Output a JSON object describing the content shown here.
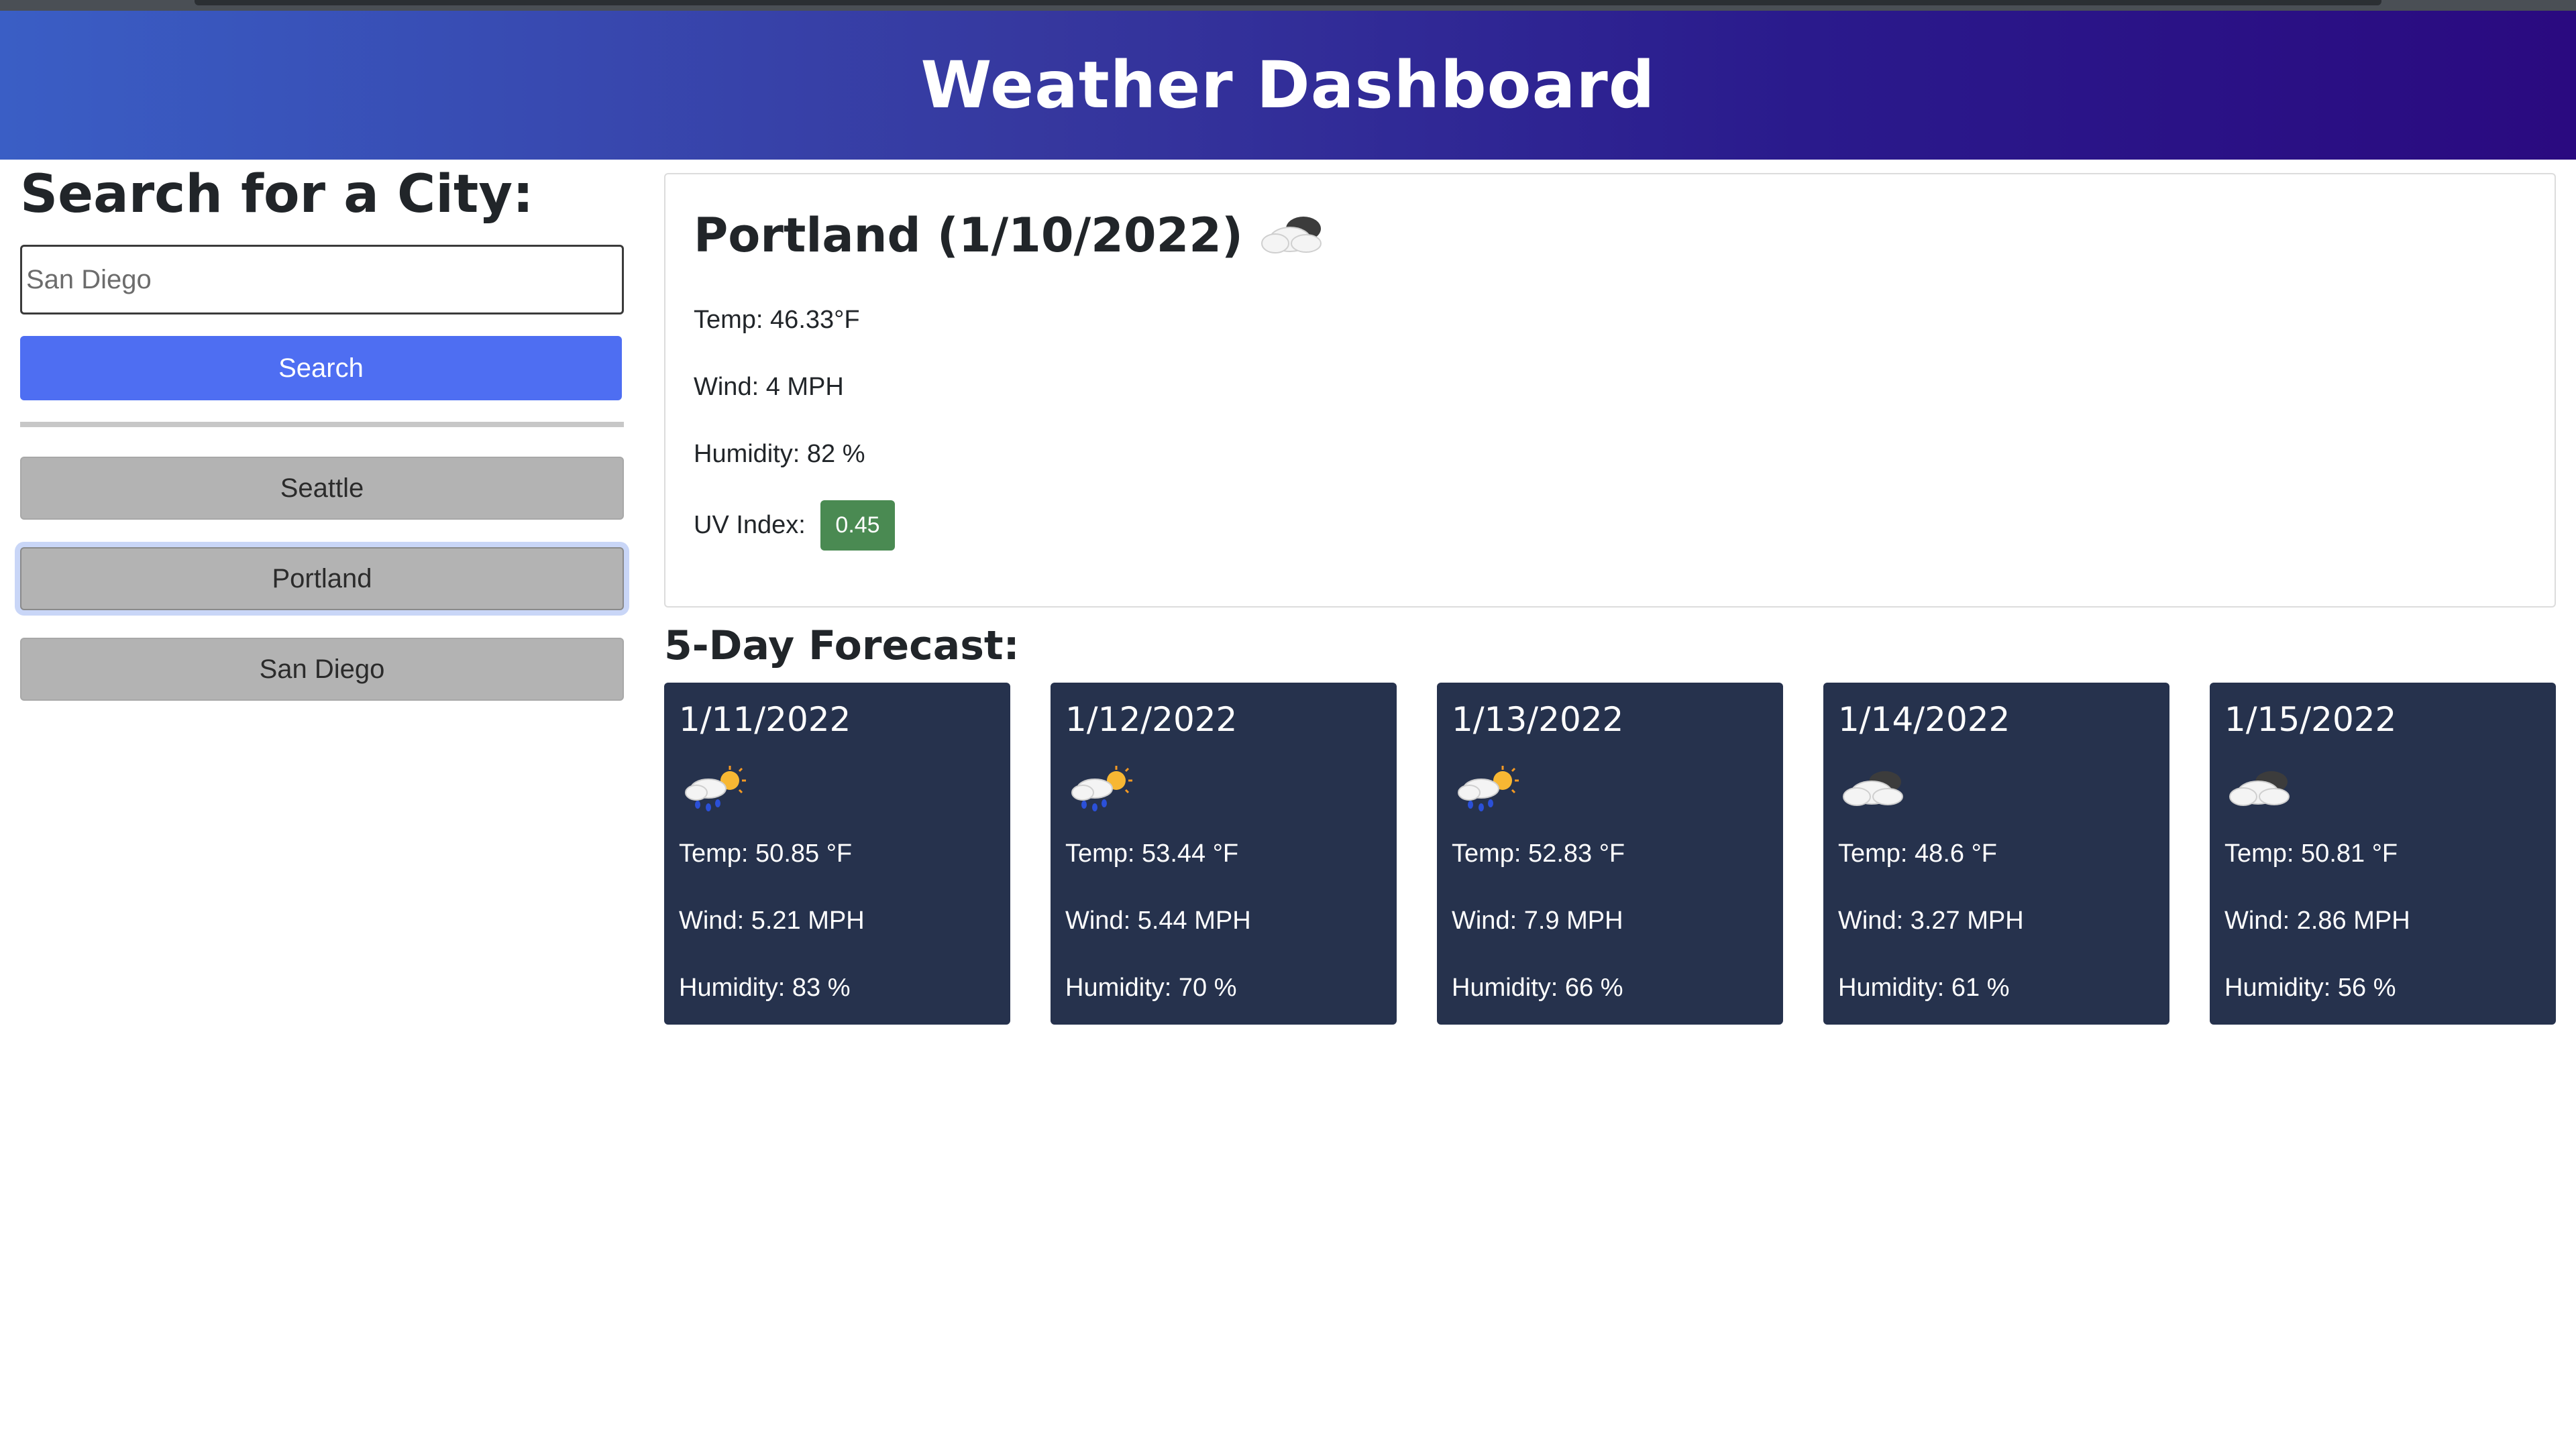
{
  "app": {
    "title": "Weather Dashboard"
  },
  "sidebar": {
    "heading": "Search for a City:",
    "search_placeholder": "San Diego",
    "search_button": "Search",
    "history": [
      "Seattle",
      "Portland",
      "San Diego"
    ],
    "active_history": "Portland"
  },
  "current": {
    "title": "Portland (1/10/2022)",
    "icon": "cloud-icon",
    "temp_label": "Temp: ",
    "temp_value": "46.33°F",
    "wind_label": "Wind: ",
    "wind_value": "4 MPH",
    "humidity_label": "Humidity: ",
    "humidity_value": "82 %",
    "uv_label": "UV Index: ",
    "uv_value": "0.45",
    "uv_color": "#4a8a52"
  },
  "forecast": {
    "heading": "5-Day Forecast:",
    "temp_label": "Temp: ",
    "wind_label": "Wind: ",
    "humidity_label": "Humidity: ",
    "days": [
      {
        "date": "1/11/2022",
        "icon": "rain-sun-icon",
        "temp": "50.85 °F",
        "wind": "5.21 MPH",
        "humidity": "83 %"
      },
      {
        "date": "1/12/2022",
        "icon": "rain-sun-icon",
        "temp": "53.44 °F",
        "wind": "5.44 MPH",
        "humidity": "70 %"
      },
      {
        "date": "1/13/2022",
        "icon": "rain-sun-icon",
        "temp": "52.83 °F",
        "wind": "7.9 MPH",
        "humidity": "66 %"
      },
      {
        "date": "1/14/2022",
        "icon": "cloud-icon",
        "temp": "48.6 °F",
        "wind": "3.27 MPH",
        "humidity": "61 %"
      },
      {
        "date": "1/15/2022",
        "icon": "cloud-icon",
        "temp": "50.81 °F",
        "wind": "2.86 MPH",
        "humidity": "56 %"
      }
    ]
  },
  "colors": {
    "header_gradient_start": "#3a5ec5",
    "header_gradient_end": "#2a0a80",
    "search_button": "#4e6ef2",
    "history_button": "#b3b3b3",
    "forecast_card": "#26324d"
  }
}
